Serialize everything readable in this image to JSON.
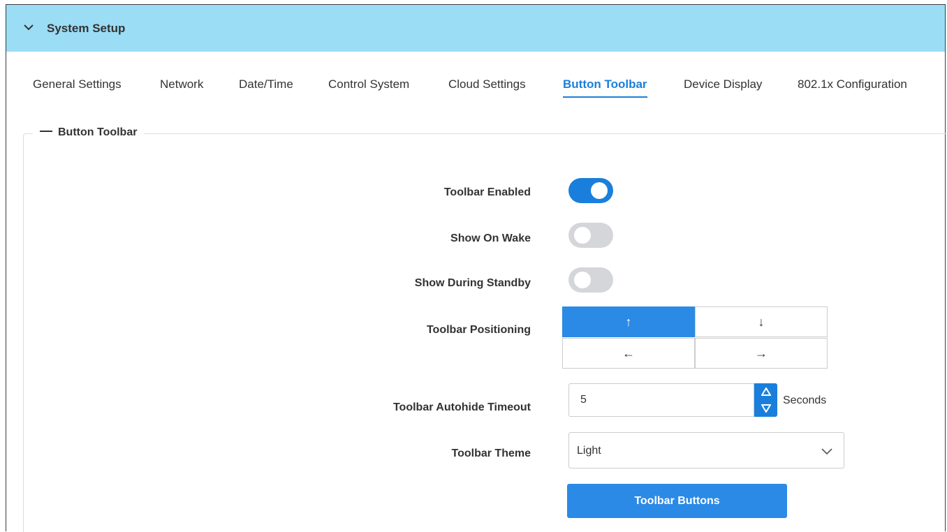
{
  "header": {
    "title": "System Setup",
    "icon": "chevron-down-icon",
    "background": "#9bddf5"
  },
  "tabs": [
    {
      "label": "General Settings",
      "active": false
    },
    {
      "label": "Network",
      "active": false
    },
    {
      "label": "Date/Time",
      "active": false
    },
    {
      "label": "Control System",
      "active": false
    },
    {
      "label": "Cloud Settings",
      "active": false
    },
    {
      "label": "Button Toolbar",
      "active": true
    },
    {
      "label": "Device Display",
      "active": false
    },
    {
      "label": "802.1x Configuration",
      "active": false
    }
  ],
  "section": {
    "title": "Button Toolbar",
    "toolbar_enabled": {
      "label": "Toolbar Enabled",
      "value": true
    },
    "show_on_wake": {
      "label": "Show On Wake",
      "value": false
    },
    "show_during_standby": {
      "label": "Show During Standby",
      "value": false
    },
    "positioning": {
      "label": "Toolbar Positioning",
      "options": [
        {
          "glyph": "↑",
          "direction": "up",
          "selected": true
        },
        {
          "glyph": "↓",
          "direction": "down",
          "selected": false
        },
        {
          "glyph": "←",
          "direction": "left",
          "selected": false
        },
        {
          "glyph": "→",
          "direction": "right",
          "selected": false
        }
      ]
    },
    "autohide": {
      "label": "Toolbar Autohide Timeout",
      "value": "5",
      "unit": "Seconds"
    },
    "theme": {
      "label": "Toolbar Theme",
      "value": "Light"
    },
    "buttons_action": {
      "label": "Toolbar Buttons"
    }
  },
  "colors": {
    "accent": "#1a7fdc",
    "toggle_off": "#d4d6da",
    "selected_button": "#2b8ae6"
  }
}
